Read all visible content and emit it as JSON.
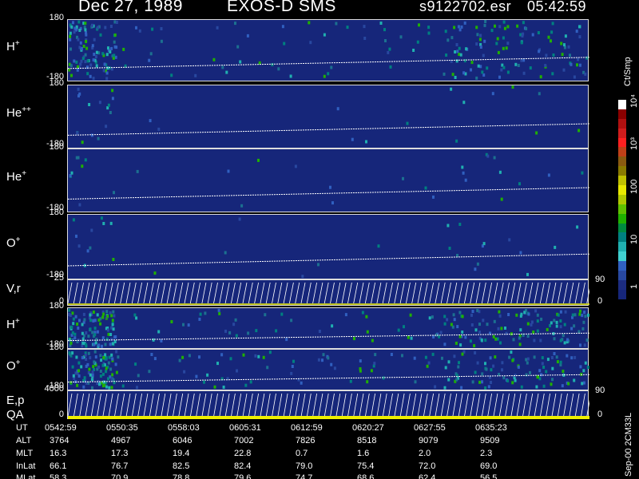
{
  "header": {
    "date": "Dec 27, 1989",
    "instrument": "EXOS-D SMS",
    "file": "s9122702.esr",
    "time": "05:42:59"
  },
  "panels": [
    {
      "label": "H",
      "sup": "+",
      "ymax": "180",
      "ymin": "-180"
    },
    {
      "label": "He",
      "sup": "++",
      "ymax": "180",
      "ymin": "-180"
    },
    {
      "label": "He",
      "sup": "+",
      "ymax": "180",
      "ymin": "-180"
    },
    {
      "label": "O",
      "sup": "+",
      "ymax": "180",
      "ymin": "-180"
    },
    {
      "label": "V,r",
      "sup": "",
      "ymax": "25",
      "ymin": "0",
      "right_top": "90",
      "right_bottom": "0"
    },
    {
      "label": "H",
      "sup": "+",
      "ymax": "180",
      "ymin": "-180"
    },
    {
      "label": "O",
      "sup": "+",
      "ymax": "180",
      "ymin": "-180"
    },
    {
      "label": "E,p",
      "label2": "QA",
      "sup": "",
      "ymax": "4000",
      "ymin": "0",
      "right_top": "90",
      "right_bottom": "0"
    }
  ],
  "colorbar": {
    "title": "Ct/Smp",
    "ticks": [
      "10⁴",
      "10³",
      "100",
      "10",
      "1"
    ],
    "colors": [
      "#ffffff",
      "#8b0000",
      "#b01010",
      "#d01c1c",
      "#ff2020",
      "#c04018",
      "#8a5a10",
      "#8a7a00",
      "#c0c000",
      "#e8e800",
      "#b0c800",
      "#60c000",
      "#20b000",
      "#008a40",
      "#008080",
      "#20b0b0",
      "#40d0d0",
      "#3060c0",
      "#2848a0",
      "#1c2c80",
      "#16267a"
    ]
  },
  "bottom_table": {
    "labels": [
      "UT",
      "ALT",
      "MLT",
      "InLat",
      "MLat"
    ],
    "columns": [
      [
        "0542:59",
        "3764",
        "16.3",
        "66.1",
        "58.3"
      ],
      [
        "0550:35",
        "4967",
        "17.3",
        "76.7",
        "70.9"
      ],
      [
        "0558:03",
        "6046",
        "19.4",
        "82.5",
        "78.8"
      ],
      [
        "0605:31",
        "7002",
        "22.8",
        "82.4",
        "79.6"
      ],
      [
        "0612:59",
        "7826",
        "0.7",
        "79.0",
        "74.7"
      ],
      [
        "0620:27",
        "8518",
        "1.6",
        "75.4",
        "68.6"
      ],
      [
        "0627:55",
        "9079",
        "2.0",
        "72.0",
        "62.4"
      ],
      [
        "0635:23",
        "9509",
        "2.3",
        "69.0",
        "56.5"
      ]
    ],
    "footer": "Sep-00  2CM33L"
  },
  "chart_data": {
    "type": "heatmap",
    "title": "Dec 27, 1989   EXOS-D SMS",
    "x": [
      "0542:59",
      "0550:35",
      "0558:03",
      "0605:31",
      "0612:59",
      "0620:27",
      "0627:55",
      "0635:23"
    ],
    "series": [
      {
        "name": "H+",
        "ylim": [
          -180,
          180
        ]
      },
      {
        "name": "He++",
        "ylim": [
          -180,
          180
        ]
      },
      {
        "name": "He+",
        "ylim": [
          -180,
          180
        ]
      },
      {
        "name": "O+",
        "ylim": [
          -180,
          180
        ]
      },
      {
        "name": "V,r",
        "ylim": [
          0,
          25
        ]
      },
      {
        "name": "H+",
        "ylim": [
          -180,
          180
        ]
      },
      {
        "name": "O+",
        "ylim": [
          -180,
          180
        ]
      },
      {
        "name": "E,p",
        "ylim": [
          0,
          4000
        ]
      }
    ],
    "color_scale": "log",
    "zlim": [
      1,
      10000
    ],
    "zlabel": "Ct/Smp"
  }
}
